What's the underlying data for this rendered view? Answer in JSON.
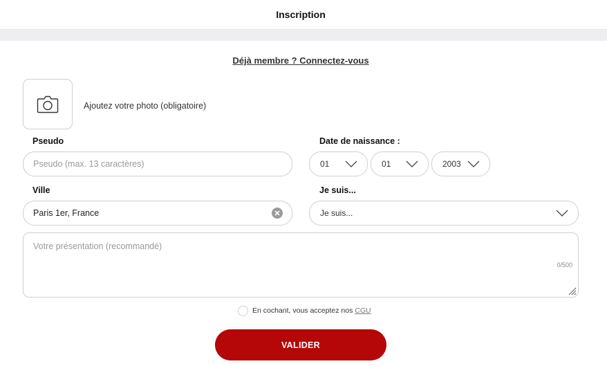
{
  "header": {
    "title": "Inscription"
  },
  "login_link": "Déjà membre ? Connectez-vous",
  "photo": {
    "label": "Ajoutez votre photo (obligatoire)",
    "icon": "camera-icon"
  },
  "pseudo": {
    "label": "Pseudo",
    "placeholder": "Pseudo (max. 13 caractères)"
  },
  "birthdate": {
    "label": "Date de naissance :",
    "day": "01",
    "month": "01",
    "year": "2003"
  },
  "city": {
    "label": "Ville",
    "value": "Paris 1er, France"
  },
  "gender": {
    "label": "Je suis...",
    "value": "Je suis..."
  },
  "presentation": {
    "placeholder": "Votre présentation (recommandé)",
    "counter": "0/500"
  },
  "terms": {
    "text": "En cochant, vous acceptez nos",
    "link": "CGU"
  },
  "submit": {
    "label": "VALIDER"
  },
  "colors": {
    "accent": "#b50707",
    "border": "#cfcfcf",
    "band": "#eeeef1"
  }
}
